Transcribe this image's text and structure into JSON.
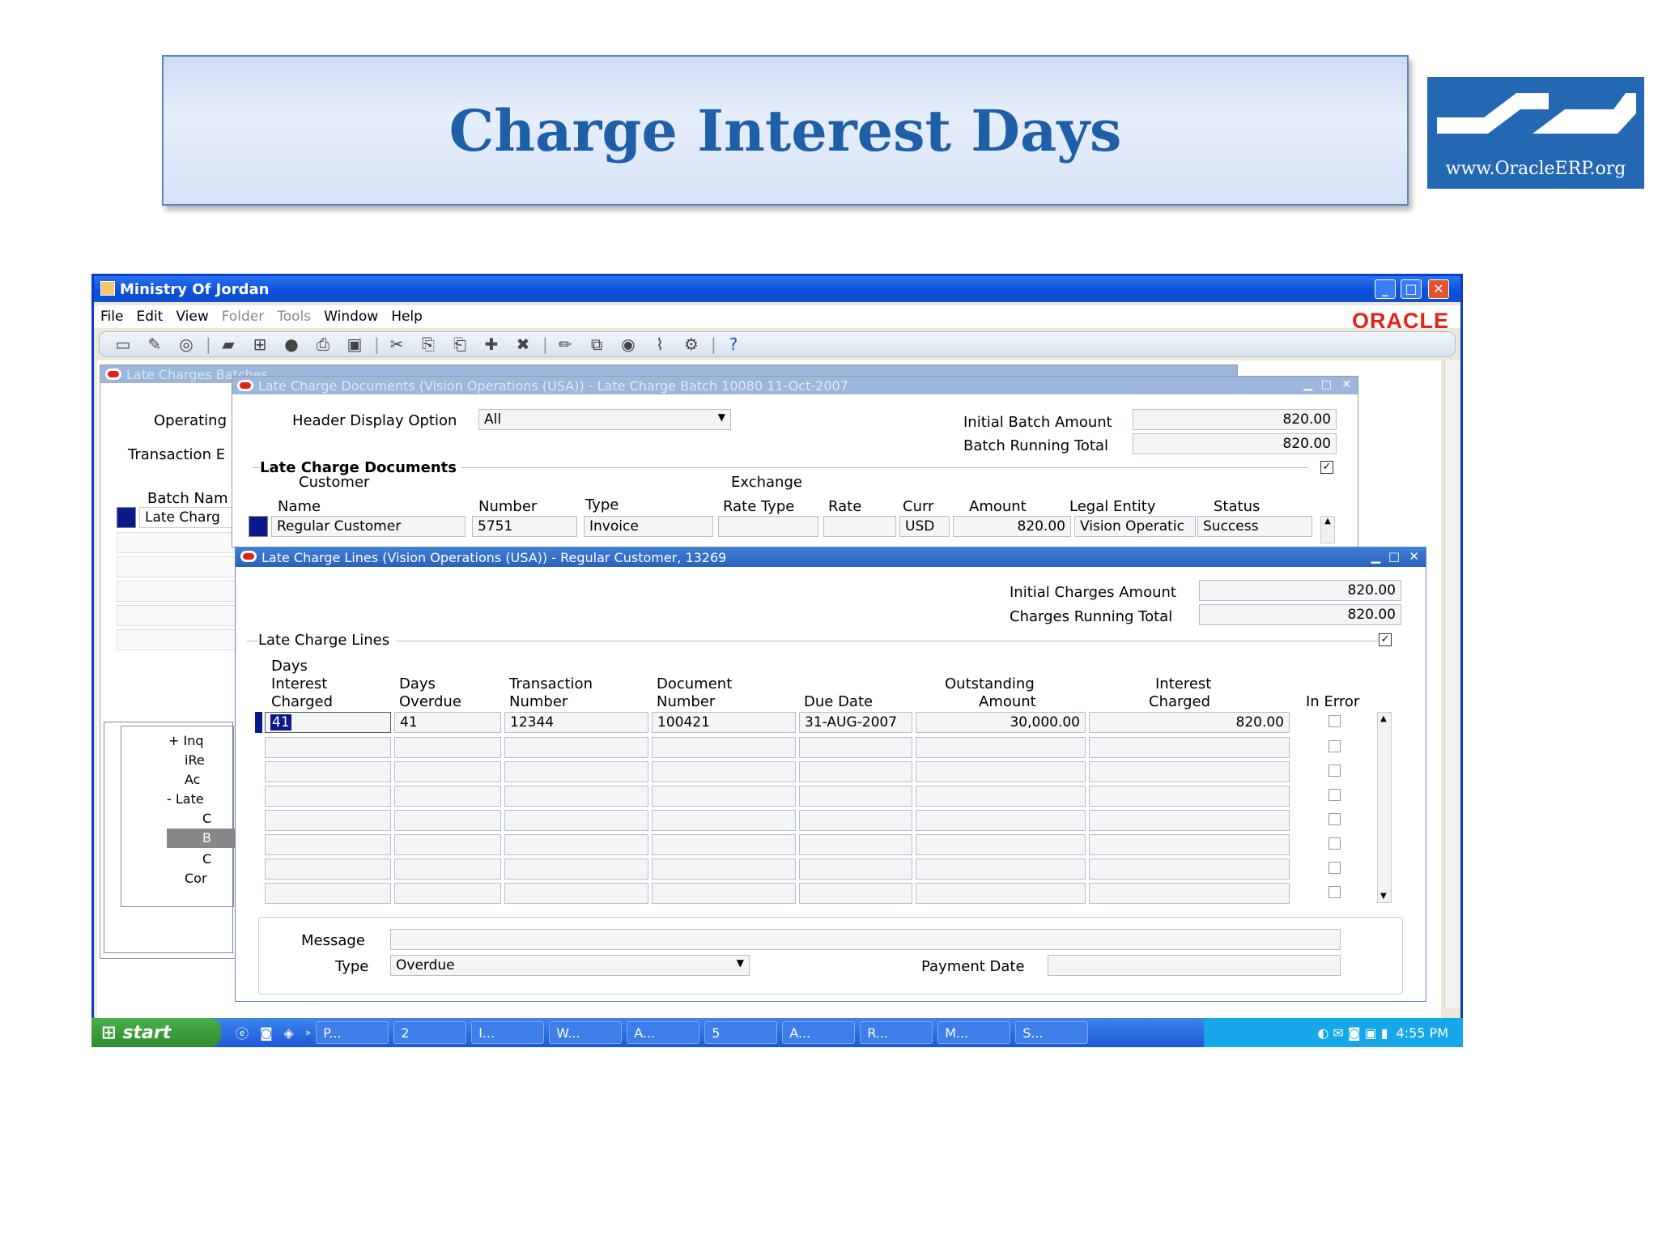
{
  "slide": {
    "title": "Charge Interest Days",
    "logo_text": "www.OracleERP.org"
  },
  "window": {
    "title": "Ministry Of Jordan",
    "brand": "ORACLE"
  },
  "menu": [
    "File",
    "Edit",
    "View",
    "Folder",
    "Tools",
    "Window",
    "Help"
  ],
  "batches": {
    "title": "Late Charges Batches",
    "labels": [
      "Operating",
      "Transaction E",
      "Batch Nam"
    ],
    "row_value": "Late Charg",
    "tree": [
      "+ Inq",
      "iRe",
      "Ac",
      "- Late",
      "C",
      "B",
      "C",
      "Cor"
    ]
  },
  "docs": {
    "title": "Late Charge Documents (Vision Operations (USA)) - Late Charge Batch 10080 11-Oct-2007",
    "header_display_label": "Header Display Option",
    "header_display_value": "All",
    "initial_batch_label": "Initial Batch Amount",
    "initial_batch_value": "820.00",
    "running_total_label": "Batch Running Total",
    "running_total_value": "820.00",
    "section": "Late Charge Documents",
    "group_customer": "Customer",
    "group_exchange": "Exchange",
    "columns": [
      "Name",
      "Number",
      "Type",
      "Rate Type",
      "Rate",
      "Curr",
      "Amount",
      "Legal Entity",
      "Status"
    ],
    "row": [
      "Regular Customer",
      "5751",
      "Invoice",
      "",
      "",
      "USD",
      "820.00",
      "Vision Operatic",
      "Success"
    ]
  },
  "lines": {
    "title": "Late Charge Lines (Vision Operations (USA)) - Regular Customer, 13269",
    "initial_charges_label": "Initial Charges Amount",
    "initial_charges_value": "820.00",
    "running_total_label": "Charges Running Total",
    "running_total_value": "820.00",
    "section": "Late Charge Lines",
    "col_days_interest": [
      "Days",
      "Interest",
      "Charged"
    ],
    "col_days_overdue": [
      "Days",
      "Overdue"
    ],
    "col_transaction": [
      "Transaction",
      "Number"
    ],
    "col_document": [
      "Document",
      "Number"
    ],
    "col_due": "Due Date",
    "col_outstanding": [
      "Outstanding",
      "Amount"
    ],
    "col_interest": [
      "Interest",
      "Charged"
    ],
    "col_error": "In Error",
    "row": [
      "41",
      "41",
      "12344",
      "100421",
      "31-AUG-2007",
      "30,000.00",
      "820.00"
    ],
    "message_label": "Message",
    "type_label": "Type",
    "type_value": "Overdue",
    "payment_date_label": "Payment Date"
  },
  "taskbar": {
    "start": "start",
    "tasks": [
      "P...",
      "2",
      "I...",
      "W...",
      "A...",
      "5",
      "A...",
      "R...",
      "M...",
      "S..."
    ],
    "time": "4:55 PM"
  }
}
